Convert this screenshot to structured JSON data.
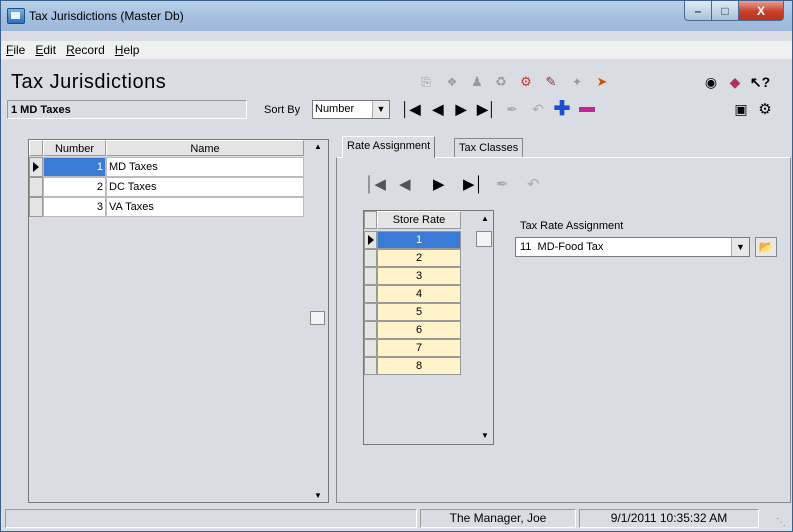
{
  "window": {
    "title": "Tax Jurisdictions (Master Db)"
  },
  "menu": [
    {
      "label": "File",
      "accel": "F",
      "rest": "ile"
    },
    {
      "label": "Edit",
      "accel": "E",
      "rest": "dit"
    },
    {
      "label": "Record",
      "accel": "R",
      "rest": "ecord"
    },
    {
      "label": "Help",
      "accel": "H",
      "rest": "elp"
    }
  ],
  "header": {
    "title": "Tax Jurisdictions",
    "current_record": "1 MD Taxes",
    "sort_by_label": "Sort By",
    "sort_by_value": "Number"
  },
  "jurisdictions_grid": {
    "columns": [
      "Number",
      "Name"
    ],
    "rows": [
      {
        "number": "1",
        "name": "MD Taxes",
        "selected": true
      },
      {
        "number": "2",
        "name": "DC Taxes",
        "selected": false
      },
      {
        "number": "3",
        "name": "VA Taxes",
        "selected": false
      }
    ]
  },
  "tabs": [
    {
      "label": "Rate Assignment",
      "active": true
    },
    {
      "label": "Tax Classes",
      "active": false
    }
  ],
  "store_rates": {
    "column": "Store Rate",
    "rows": [
      "1",
      "2",
      "3",
      "4",
      "5",
      "6",
      "7",
      "8"
    ],
    "selected_index": 0
  },
  "tax_rate_assignment": {
    "label": "Tax Rate Assignment",
    "value": "11  MD-Food Tax"
  },
  "statusbar": {
    "user": "The Manager, Joe",
    "datetime": "9/1/2011 10:35:32 AM"
  },
  "colors": {
    "selection": "#3a7bd5",
    "store_rate_cell": "#fff3c9",
    "window_bg": "#d9dde3"
  }
}
